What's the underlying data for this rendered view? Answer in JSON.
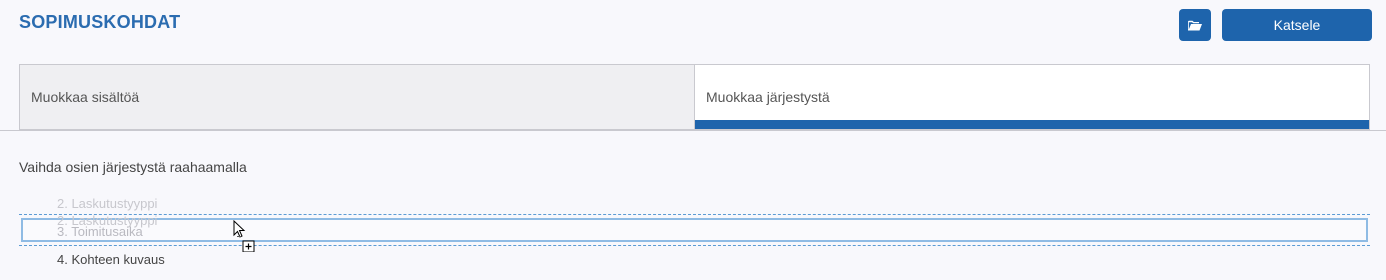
{
  "header": {
    "title": "SOPIMUSKOHDAT",
    "open_icon": "folder-open-icon",
    "view_button_label": "Katsele"
  },
  "tabs": [
    {
      "label": "Muokkaa sisältöä",
      "active": false
    },
    {
      "label": "Muokkaa järjestystä",
      "active": true
    }
  ],
  "instruction": "Vaihda osien järjestystä raahaamalla",
  "items": [
    {
      "label": "2. Laskutustyyppi"
    },
    {
      "label": "2. Laskutustyyppi"
    },
    {
      "label": "3. Toimitusaika"
    },
    {
      "label": "4. Kohteen kuvaus"
    }
  ],
  "colors": {
    "accent": "#1e64ac",
    "title": "#2b6cb0",
    "drop_indicator": "#5b9bd5"
  }
}
